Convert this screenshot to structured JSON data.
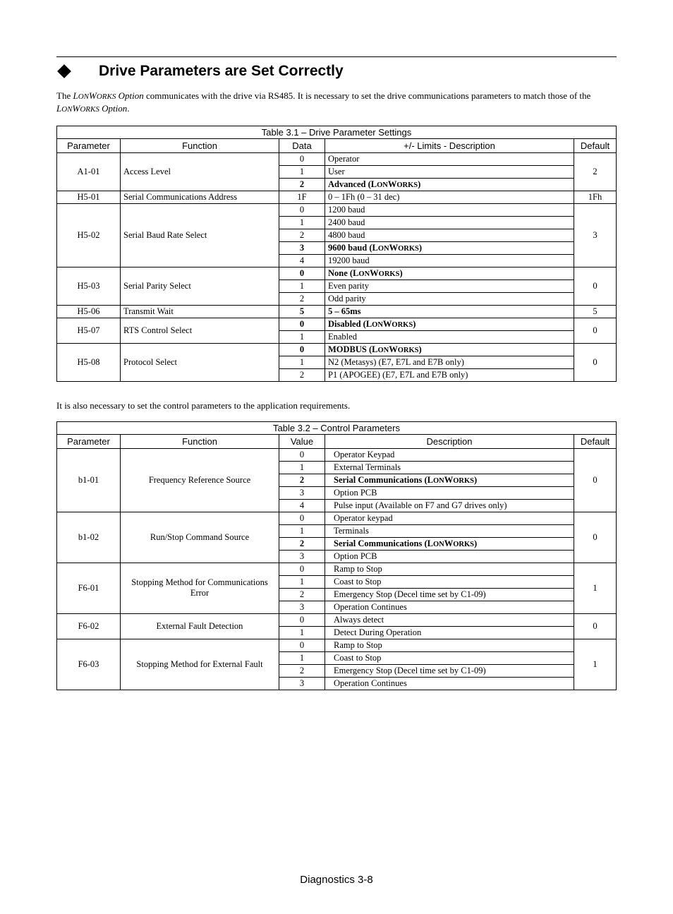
{
  "header": {
    "title": "Drive Parameters are Set Correctly"
  },
  "intro": {
    "text1": "The ",
    "lw1": "LONWORKS",
    "text2": " Option",
    "text3": " communicates with the drive via RS485. It is necessary to set the drive communications parameters to match those of the ",
    "lw2": "LONWORKS",
    "text4": " Option",
    "text5": "."
  },
  "table1": {
    "caption": "Table 3.1 – Drive Parameter Settings",
    "headers": {
      "c1": "Parameter",
      "c2": "Function",
      "c3": "Data",
      "c4": "+/- Limits - Description",
      "c5": "Default"
    },
    "rows": [
      {
        "param": "A1-01",
        "func": "Access Level",
        "default": "2",
        "items": [
          {
            "data": "0",
            "desc": "Operator",
            "bold": false
          },
          {
            "data": "1",
            "desc": "User",
            "bold": false
          },
          {
            "data": "2",
            "desc": "Advanced (LONWORKS)",
            "bold": true,
            "lw": true
          }
        ]
      },
      {
        "param": "H5-01",
        "func": "Serial Communications Address",
        "default": "1Fh",
        "items": [
          {
            "data": "1F",
            "desc": "0 – 1Fh (0 – 31 dec)",
            "bold": false
          }
        ]
      },
      {
        "param": "H5-02",
        "func": "Serial Baud Rate Select",
        "default": "3",
        "items": [
          {
            "data": "0",
            "desc": "1200 baud",
            "bold": false
          },
          {
            "data": "1",
            "desc": "2400 baud",
            "bold": false
          },
          {
            "data": "2",
            "desc": "4800 baud",
            "bold": false
          },
          {
            "data": "3",
            "desc": "9600 baud (LONWORKS)",
            "bold": true,
            "lw": true
          },
          {
            "data": "4",
            "desc": "19200 baud",
            "bold": false
          }
        ]
      },
      {
        "param": "H5-03",
        "func": "Serial Parity Select",
        "default": "0",
        "items": [
          {
            "data": "0",
            "desc": "None (LONWORKS)",
            "bold": true,
            "lw": true
          },
          {
            "data": "1",
            "desc": "Even parity",
            "bold": false
          },
          {
            "data": "2",
            "desc": "Odd parity",
            "bold": false
          }
        ]
      },
      {
        "param": "H5-06",
        "func": "Transmit Wait",
        "default": "5",
        "items": [
          {
            "data": "5",
            "desc": "5 – 65ms",
            "bold": true
          }
        ]
      },
      {
        "param": "H5-07",
        "func": "RTS Control Select",
        "default": "0",
        "items": [
          {
            "data": "0",
            "desc": "Disabled (LONWORKS)",
            "bold": true,
            "lw": true
          },
          {
            "data": "1",
            "desc": "Enabled",
            "bold": false
          }
        ]
      },
      {
        "param": "H5-08",
        "func": "Protocol Select",
        "default": "0",
        "items": [
          {
            "data": "0",
            "desc": "MODBUS (LONWORKS)",
            "bold": true,
            "lw": true
          },
          {
            "data": "1",
            "desc": "N2 (Metasys) (E7, E7L and E7B only)",
            "bold": false
          },
          {
            "data": "2",
            "desc": "P1 (APOGEE) (E7, E7L and E7B only)",
            "bold": false
          }
        ]
      }
    ]
  },
  "para2": "It is also necessary to set the control parameters to the application requirements.",
  "table2": {
    "caption": "Table 3.2 – Control Parameters",
    "headers": {
      "c1": "Parameter",
      "c2": "Function",
      "c3": "Value",
      "c4": "Description",
      "c5": "Default"
    },
    "rows": [
      {
        "param": "b1-01",
        "func": "Frequency Reference Source",
        "default": "0",
        "funcCenter": true,
        "items": [
          {
            "data": "0",
            "desc": "Operator Keypad",
            "bold": false
          },
          {
            "data": "1",
            "desc": "External Terminals",
            "bold": false
          },
          {
            "data": "2",
            "desc": "Serial Communications (LONWORKS)",
            "bold": true,
            "lw": true
          },
          {
            "data": "3",
            "desc": "Option PCB",
            "bold": false
          },
          {
            "data": "4",
            "desc": "Pulse input (Available on F7 and G7 drives only)",
            "bold": false
          }
        ]
      },
      {
        "param": "b1-02",
        "func": "Run/Stop Command Source",
        "default": "0",
        "funcCenter": true,
        "items": [
          {
            "data": "0",
            "desc": "Operator keypad",
            "bold": false
          },
          {
            "data": "1",
            "desc": "Terminals",
            "bold": false
          },
          {
            "data": "2",
            "desc": "Serial Communications (LONWORKS)",
            "bold": true,
            "lw": true
          },
          {
            "data": "3",
            "desc": "Option PCB",
            "bold": false
          }
        ]
      },
      {
        "param": "F6-01",
        "func": "Stopping Method for Communications Error",
        "default": "1",
        "funcCenter": true,
        "items": [
          {
            "data": "0",
            "desc": "Ramp to Stop",
            "bold": false
          },
          {
            "data": "1",
            "desc": "Coast to Stop",
            "bold": false
          },
          {
            "data": "2",
            "desc": "Emergency Stop (Decel time set by C1-09)",
            "bold": false
          },
          {
            "data": "3",
            "desc": "Operation Continues",
            "bold": false
          }
        ]
      },
      {
        "param": "F6-02",
        "func": "External Fault Detection",
        "default": "0",
        "funcCenter": true,
        "items": [
          {
            "data": "0",
            "desc": "Always detect",
            "bold": false
          },
          {
            "data": "1",
            "desc": "Detect During Operation",
            "bold": false
          }
        ]
      },
      {
        "param": "F6-03",
        "func": "Stopping Method for External Fault",
        "default": "1",
        "funcCenter": true,
        "items": [
          {
            "data": "0",
            "desc": "Ramp to Stop",
            "bold": false
          },
          {
            "data": "1",
            "desc": "Coast to Stop",
            "bold": false
          },
          {
            "data": "2",
            "desc": "Emergency Stop (Decel time set by C1-09)",
            "bold": false
          },
          {
            "data": "3",
            "desc": "Operation Continues",
            "bold": false
          }
        ]
      }
    ]
  },
  "footer": "Diagnostics 3-8"
}
